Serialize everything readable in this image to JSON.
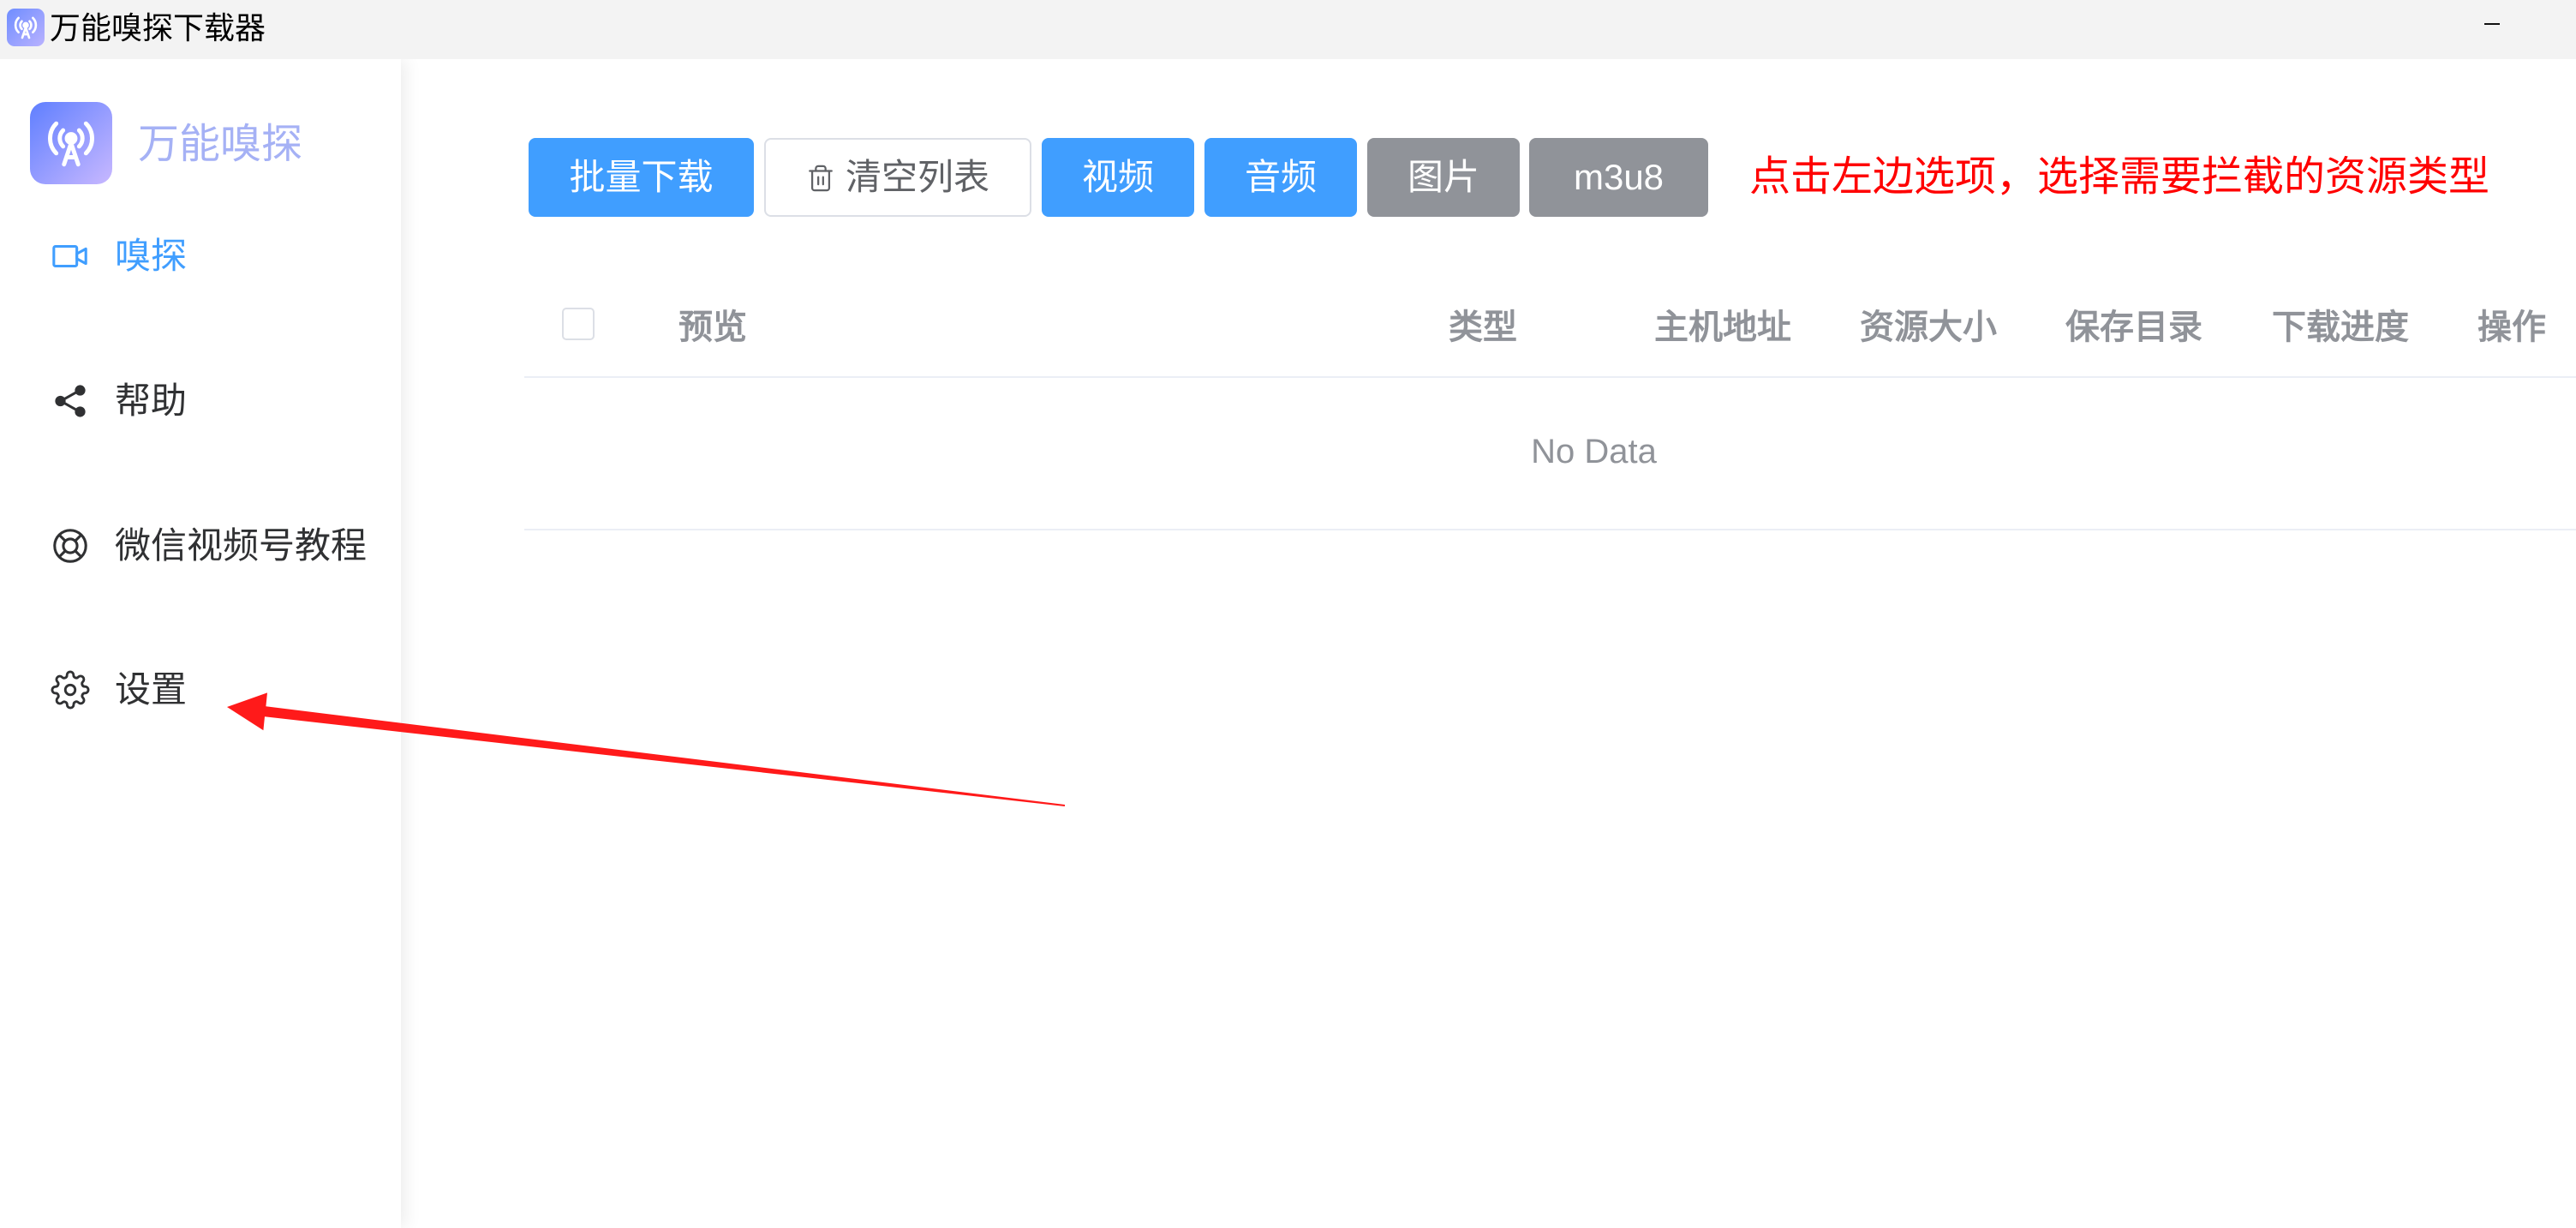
{
  "window": {
    "title": "万能嗅探下载器",
    "app_icon": "antenna-icon",
    "minimize_icon": "minimize-icon"
  },
  "sidebar": {
    "brand": "万能嗅探",
    "logo_icon": "antenna-icon",
    "items": [
      {
        "label": "嗅探",
        "icon": "video-camera-icon",
        "active": true
      },
      {
        "label": "帮助",
        "icon": "share-icon",
        "active": false
      },
      {
        "label": "微信视频号教程",
        "icon": "lifebuoy-icon",
        "active": false
      },
      {
        "label": "设置",
        "icon": "gear-icon",
        "active": false
      }
    ]
  },
  "toolbar": {
    "batch_download": "批量下载",
    "clear_list": "清空列表",
    "clear_icon": "trash-icon",
    "filters": [
      {
        "label": "视频",
        "selected": true
      },
      {
        "label": "音频",
        "selected": true
      },
      {
        "label": "图片",
        "selected": false
      },
      {
        "label": "m3u8",
        "selected": false
      }
    ],
    "hint": "点击左边选项，选择需要拦截的资源类型"
  },
  "table": {
    "columns": [
      "预览",
      "类型",
      "主机地址",
      "资源大小",
      "保存目录",
      "下载进度",
      "操作"
    ],
    "empty_text": "No Data"
  },
  "annotation": {
    "arrow_color": "#ff1a1a",
    "points_to": "设置"
  },
  "colors": {
    "primary": "#409eff",
    "muted": "#909399",
    "hint": "#ff0000",
    "text": "#303133",
    "brand": "#a5b1f5"
  }
}
